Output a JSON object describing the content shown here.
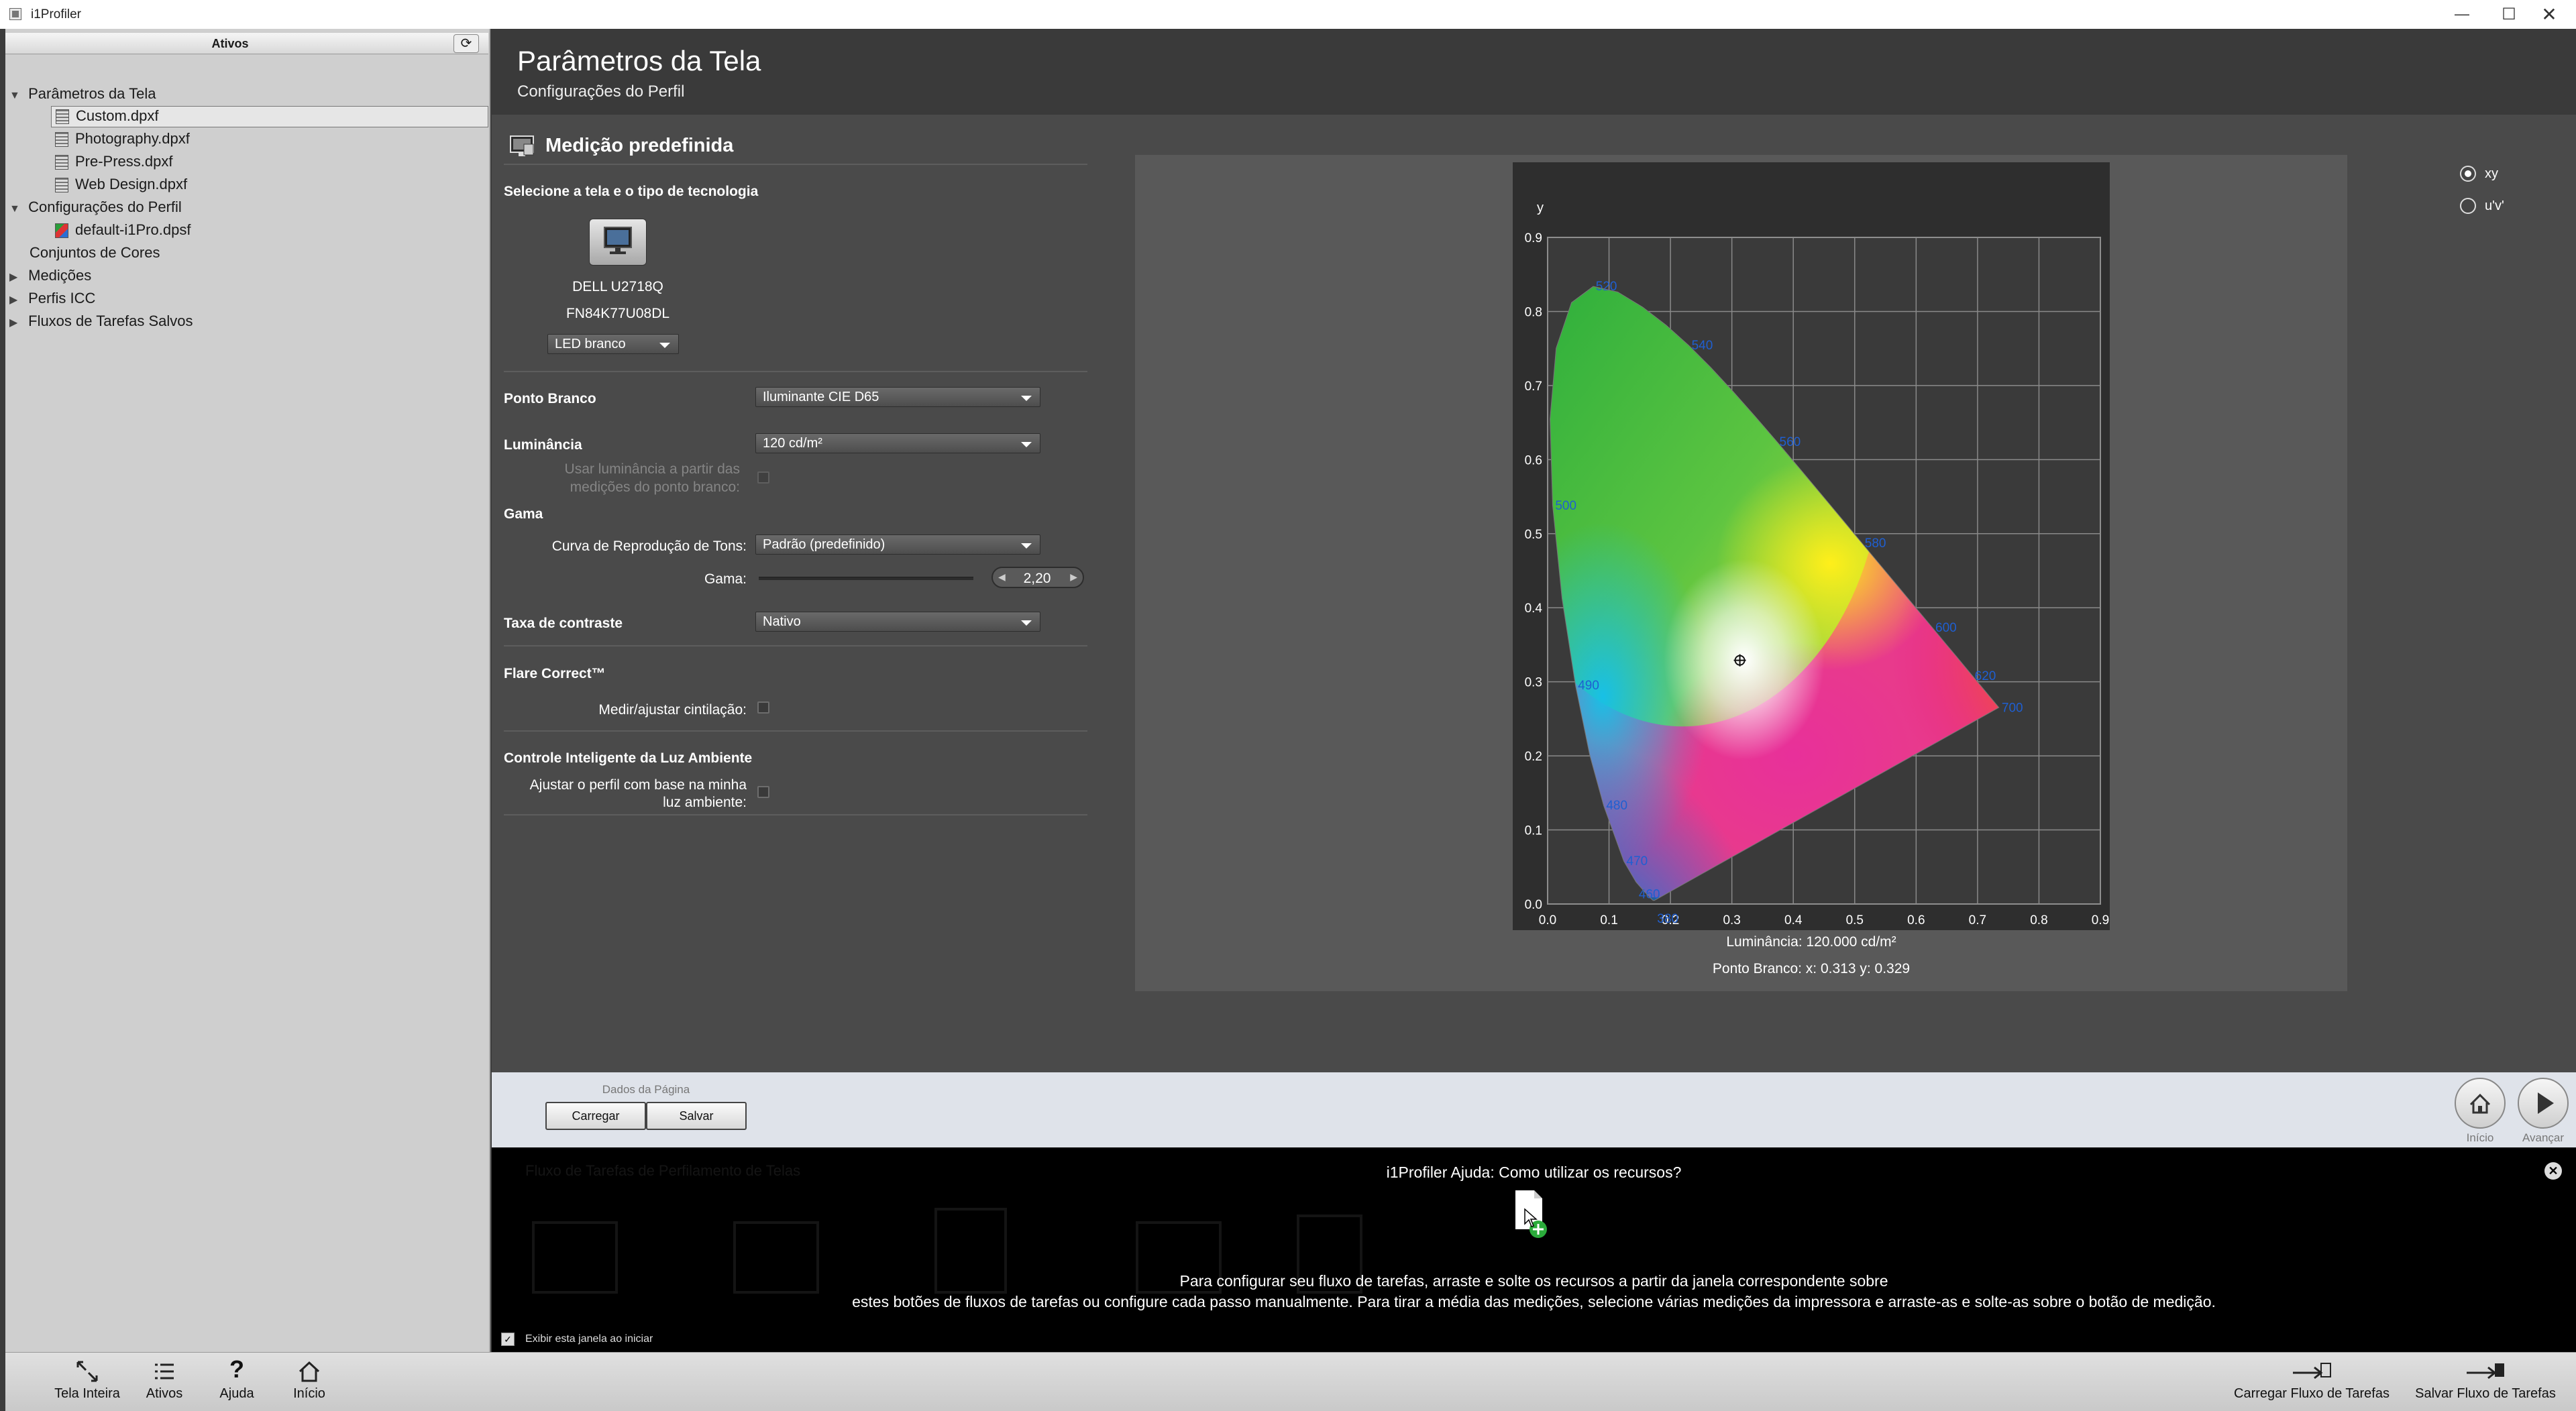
{
  "window": {
    "title": "i1Profiler"
  },
  "sidebar": {
    "header": "Ativos",
    "items": [
      {
        "label": "Parâmetros da Tela",
        "type": "folder-open"
      },
      {
        "label": "Custom.dpxf",
        "type": "file",
        "selected": true
      },
      {
        "label": "Photography.dpxf",
        "type": "file"
      },
      {
        "label": "Pre-Press.dpxf",
        "type": "file"
      },
      {
        "label": "Web Design.dpxf",
        "type": "file"
      },
      {
        "label": "Configurações do Perfil",
        "type": "folder-open"
      },
      {
        "label": "default-i1Pro.dpsf",
        "type": "file"
      },
      {
        "label": "Conjuntos de Cores",
        "type": "leaf"
      },
      {
        "label": "Medições",
        "type": "folder-closed"
      },
      {
        "label": "Perfis ICC",
        "type": "folder-closed"
      },
      {
        "label": "Fluxos de Tarefas Salvos",
        "type": "folder-closed"
      }
    ]
  },
  "header": {
    "title": "Parâmetros da Tela",
    "subtitle": "Configurações do Perfil"
  },
  "section": {
    "title": "Medição predefinida",
    "select_display": "Selecione a tela e o tipo de tecnologia",
    "monitor_name": "DELL U2718Q",
    "monitor_serial": "FN84K77U08DL",
    "technology": "LED branco",
    "white_point_label": "Ponto Branco",
    "white_point_value": "Iluminante CIE D65",
    "luminance_label": "Luminância",
    "luminance_value": "120 cd/m²",
    "use_luminance_label_1": "Usar luminância a partir das",
    "use_luminance_label_2": "medições do ponto branco:",
    "gamma_section": "Gama",
    "trc_label": "Curva de Reprodução de Tons:",
    "trc_value": "Padrão (predefinido)",
    "gamma_label": "Gama:",
    "gamma_value": "2,20",
    "gamma_slider_level": 0.57,
    "contrast_label": "Taxa de contraste",
    "contrast_value": "Nativo",
    "flare_title": "Flare Correct™",
    "flare_label": "Medir/ajustar cintilação:",
    "ambient_title": "Controle Inteligente da Luz Ambiente",
    "ambient_label_1": "Ajustar o perfil com base na minha",
    "ambient_label_2": "luz ambiente:"
  },
  "chart": {
    "radio_xy": "xy",
    "radio_uv": "u'v'",
    "luminance_text": "Luminância: 120.000 cd/m²",
    "whitepoint_text": "Ponto Branco: x: 0.313  y: 0.329"
  },
  "chart_data": {
    "type": "scatter",
    "title": "",
    "xlabel": "x",
    "ylabel": "y",
    "xlim": [
      0,
      0.9
    ],
    "ylim": [
      0,
      0.9
    ],
    "grid": true,
    "x_ticks": [
      "0.0",
      "0.1",
      "0.2",
      "0.3",
      "0.4",
      "0.5",
      "0.6",
      "0.7",
      "0.8",
      "0.9"
    ],
    "y_ticks": [
      "0.0",
      "0.1",
      "0.2",
      "0.3",
      "0.4",
      "0.5",
      "0.6",
      "0.7",
      "0.8",
      "0.9"
    ],
    "white_point": {
      "x": 0.313,
      "y": 0.329
    },
    "wavelength_labels": [
      {
        "label": "380",
        "x": 0.174,
        "y": -0.02
      },
      {
        "label": "460",
        "x": 0.144,
        "y": 0.013
      },
      {
        "label": "470",
        "x": 0.124,
        "y": 0.058
      },
      {
        "label": "480",
        "x": 0.091,
        "y": 0.133
      },
      {
        "label": "490",
        "x": 0.045,
        "y": 0.295
      },
      {
        "label": "500",
        "x": 0.008,
        "y": 0.538
      },
      {
        "label": "520",
        "x": 0.074,
        "y": 0.834
      },
      {
        "label": "540",
        "x": 0.23,
        "y": 0.754
      },
      {
        "label": "560",
        "x": 0.373,
        "y": 0.624
      },
      {
        "label": "580",
        "x": 0.512,
        "y": 0.487
      },
      {
        "label": "600",
        "x": 0.627,
        "y": 0.373
      },
      {
        "label": "620",
        "x": 0.691,
        "y": 0.308
      },
      {
        "label": "700",
        "x": 0.735,
        "y": 0.265
      }
    ]
  },
  "navbar": {
    "group_label": "Dados da Página",
    "load_label": "Carregar",
    "save_label": "Salvar",
    "home_label": "Início",
    "next_label": "Avançar"
  },
  "help": {
    "ghost_title": "Fluxo de Tarefas de Perfilamento de Telas",
    "title": "i1Profiler Ajuda: Como utilizar os recursos?",
    "line1": "Para configurar seu fluxo de tarefas, arraste e solte os recursos a partir da janela correspondente sobre",
    "line2": "estes botões de fluxos de tarefas ou configure cada passo manualmente. Para tirar a média das medições, selecione várias medições da impressora e arraste-as e solte-as sobre o botão de medição.",
    "show_on_start": "Exibir esta janela ao iniciar"
  },
  "toolbar": {
    "fullscreen": "Tela Inteira",
    "assets": "Ativos",
    "help": "Ajuda",
    "home": "Início",
    "load_workflow": "Carregar Fluxo de Tarefas",
    "save_workflow": "Salvar Fluxo de Tarefas"
  }
}
